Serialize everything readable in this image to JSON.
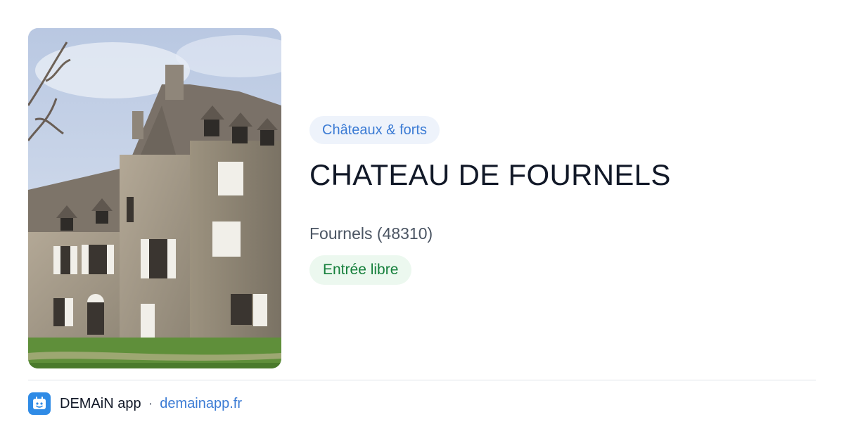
{
  "card": {
    "image_alt": "Château de Fournels",
    "category": "Châteaux & forts",
    "title": "CHATEAU DE FOURNELS",
    "location": "Fournels (48310)",
    "access": "Entrée libre"
  },
  "footer": {
    "app_name": "DEMAiN app",
    "separator": "·",
    "site": "demainapp.fr"
  },
  "colors": {
    "category_bg": "#eef3fb",
    "category_text": "#3b7bd4",
    "access_bg": "#ecf8ef",
    "access_text": "#16803c",
    "logo_bg": "#2f8be6"
  },
  "icons": {
    "logo": "demain-app-logo-icon"
  }
}
